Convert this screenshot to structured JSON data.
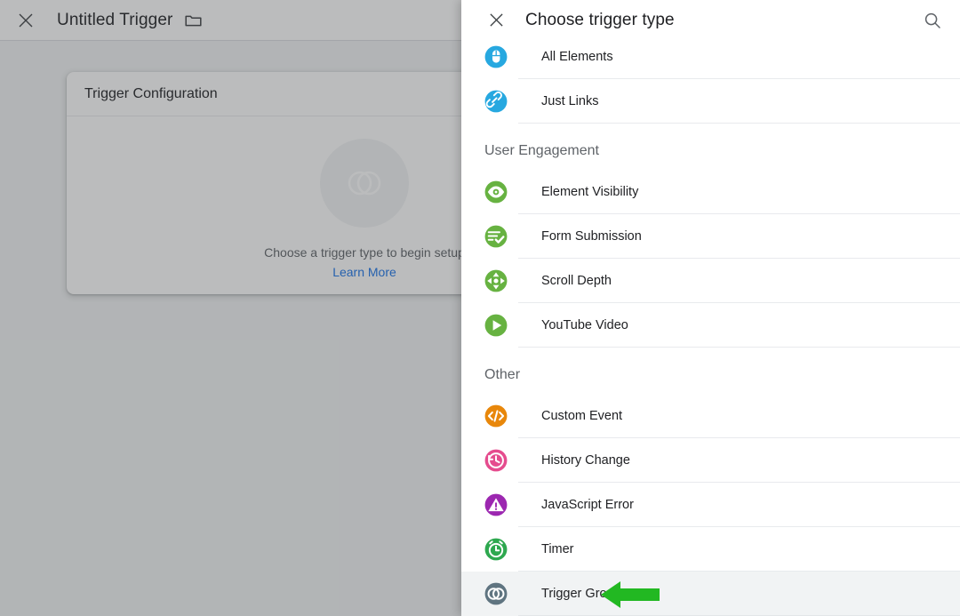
{
  "app_header": {
    "close_icon": "close-icon",
    "title": "Untitled Trigger",
    "folder_icon": "folder-icon"
  },
  "trigger_config_card": {
    "heading": "Trigger Configuration",
    "empty_icon": "trigger-group-emblem-icon",
    "empty_text": "Choose a trigger type to begin setup",
    "learn_more_label": "Learn More"
  },
  "panel": {
    "close_icon": "close-icon",
    "title": "Choose trigger type",
    "search_icon": "search-icon",
    "sections": [
      {
        "title": null,
        "items": [
          {
            "label": "All Elements",
            "icon": "mouse-icon",
            "color": "#27A8E0",
            "highlighted": false
          },
          {
            "label": "Just Links",
            "icon": "link-icon",
            "color": "#27A8E0",
            "highlighted": false
          }
        ]
      },
      {
        "title": "User Engagement",
        "items": [
          {
            "label": "Element Visibility",
            "icon": "eye-icon",
            "color": "#67B241",
            "highlighted": false
          },
          {
            "label": "Form Submission",
            "icon": "form-check-icon",
            "color": "#67B241",
            "highlighted": false
          },
          {
            "label": "Scroll Depth",
            "icon": "scroll-arrows-icon",
            "color": "#67B241",
            "highlighted": false
          },
          {
            "label": "YouTube Video",
            "icon": "play-icon",
            "color": "#67B241",
            "highlighted": false
          }
        ]
      },
      {
        "title": "Other",
        "items": [
          {
            "label": "Custom Event",
            "icon": "code-brackets-icon",
            "color": "#E8870B",
            "highlighted": false
          },
          {
            "label": "History Change",
            "icon": "history-clock-icon",
            "color": "#E54C8E",
            "highlighted": false
          },
          {
            "label": "JavaScript Error",
            "icon": "warning-triangle-icon",
            "color": "#9C27B0",
            "highlighted": false
          },
          {
            "label": "Timer",
            "icon": "alarm-clock-icon",
            "color": "#2EA84F",
            "highlighted": false
          },
          {
            "label": "Trigger Group",
            "icon": "trigger-group-icon",
            "color": "#5F7480",
            "highlighted": true
          }
        ]
      }
    ]
  },
  "annotation": {
    "arrow_icon": "left-arrow-annotation-icon",
    "color": "#22B822"
  },
  "colors": {
    "scrim": "#3C4043",
    "highlight_row": "#F1F3F4",
    "link": "#1A73E8",
    "divider": "#E8EAED"
  }
}
